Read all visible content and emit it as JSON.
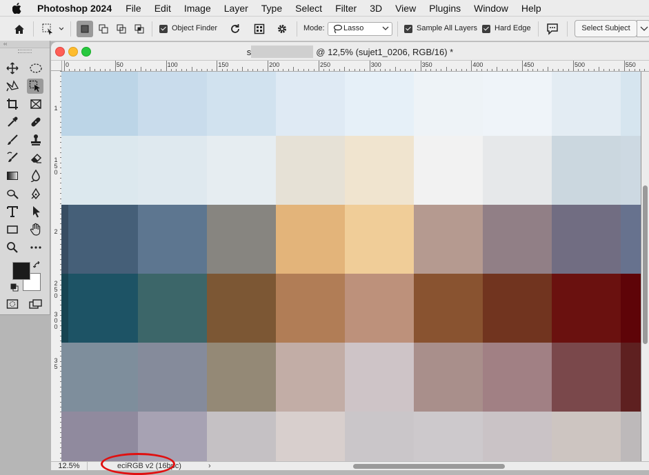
{
  "menubar": {
    "app_name": "Photoshop 2024",
    "items": [
      "File",
      "Edit",
      "Image",
      "Layer",
      "Type",
      "Select",
      "Filter",
      "3D",
      "View",
      "Plugins",
      "Window",
      "Help"
    ]
  },
  "options_bar": {
    "object_finder_label": "Object Finder",
    "object_finder_checked": true,
    "mode_label": "Mode:",
    "mode_value": "Lasso",
    "sample_all_layers_label": "Sample All Layers",
    "sample_all_layers_checked": true,
    "hard_edge_label": "Hard Edge",
    "hard_edge_checked": true,
    "select_subject_label": "Select Subject"
  },
  "tools_panel": {
    "header_glyph": "‹‹",
    "tools": [
      "move",
      "marquee-ellipse",
      "lasso",
      "object-selection",
      "crop",
      "frame",
      "eyedropper",
      "healing",
      "brush",
      "stamp",
      "history-brush",
      "eraser",
      "gradient",
      "blur",
      "dodge",
      "pen",
      "type",
      "path-selection",
      "rectangle",
      "hand",
      "zoom",
      "more"
    ]
  },
  "document": {
    "title_suffix": "@ 12,5% (sujet1_0206, RGB/16) *",
    "title_prefix_visible": "s",
    "ruler_h_labels": [
      "0",
      "50",
      "100",
      "150",
      "200",
      "250",
      "300",
      "350",
      "400",
      "450",
      "500",
      "550"
    ],
    "ruler_v_labels": [
      "1",
      "1 5 0",
      "2",
      "2 5 0",
      "3 0 0",
      "3 5"
    ],
    "zoom_level": "12.5%",
    "color_profile": "eciRGB v2 (16bpc)",
    "status_arrow": "›"
  },
  "canvas_grid": [
    [
      "#bcd5e7",
      "#c9dcec",
      "#d1e2ef",
      "#dfeaf4",
      "#e6f0f8",
      "#eef3f7",
      "#eff4f9",
      "#e3ecf3",
      "#d6e5ef"
    ],
    [
      "#dce8ee",
      "#dfe9ef",
      "#e6edf1",
      "#e6e1d6",
      "#f0e4cf",
      "#f2f2f2",
      "#e6e8ea",
      "#cbd7df",
      "#cdd9e2"
    ],
    [
      "#455f78",
      "#5d7690",
      "#878580",
      "#e3b47a",
      "#f0cd98",
      "#b59a90",
      "#917f86",
      "#716d82",
      "#67728e"
    ],
    [
      "#1d5365",
      "#3c6669",
      "#7c5734",
      "#b17d56",
      "#bd917b",
      "#895330",
      "#71341f",
      "#6a110f",
      "#5e0408"
    ],
    [
      "#7e8e9c",
      "#858b9b",
      "#948976",
      "#c2ada6",
      "#cec4c7",
      "#a98f8b",
      "#a18084",
      "#7a484b",
      "#5e2020"
    ],
    [
      "#908a9e",
      "#a7a2b3",
      "#c5c1c4",
      "#d8cfcd",
      "#cac6c9",
      "#cdc9cc",
      "#cac3c6",
      "#cdc5c1",
      "#bdb9ba"
    ]
  ]
}
